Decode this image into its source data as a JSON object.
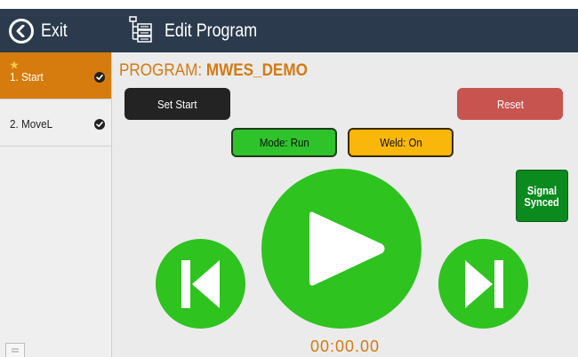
{
  "header": {
    "exit_label": "Exit",
    "title": "Edit Program",
    "background": "#2b3a4d"
  },
  "sidebar": {
    "steps": [
      {
        "label": "1. Start",
        "active": true,
        "starred": true,
        "completed": true
      },
      {
        "label": "2. MoveL",
        "active": false,
        "starred": false,
        "completed": true
      }
    ]
  },
  "program": {
    "prefix": "PROGRAM:",
    "name": "MWES_DEMO"
  },
  "buttons": {
    "set_start": "Set Start",
    "reset": "Reset",
    "mode": "Mode: Run",
    "weld": "Weld: On",
    "signal_line1": "Signal",
    "signal_line2": "Synced"
  },
  "playback": {
    "timer": "00:00.00"
  },
  "icons": {
    "exit": "back-arrow-icon",
    "program": "program-tree-icon",
    "prev": "skip-previous-icon",
    "play": "play-icon",
    "next": "skip-next-icon"
  },
  "colors": {
    "accent": "#d47a12",
    "active_step": "#d67b0d",
    "play_green": "#2ec31f",
    "reset_red": "#c85450",
    "mode_green": "#2ec32b",
    "weld_yellow": "#f9b70b",
    "signal_green": "#0b8a1d"
  }
}
